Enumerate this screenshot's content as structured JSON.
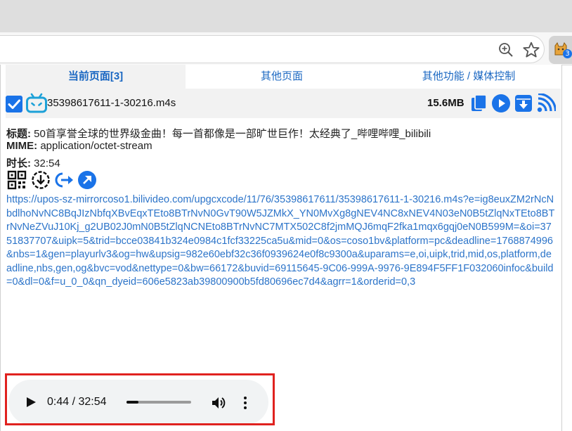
{
  "tabs": [
    {
      "label": "当前页面[3]",
      "active": true
    },
    {
      "label": "其他页面",
      "active": false
    },
    {
      "label": "其他功能 / 媒体控制",
      "active": false
    }
  ],
  "extension": {
    "badge": "3"
  },
  "media": {
    "filename": "35398617611-1-30216.m4s",
    "size": "15.6MB",
    "checked": true
  },
  "info": {
    "title_label": "标题:",
    "title_value": "50首享誉全球的世界级金曲！每一首都像是一部旷世巨作！太经典了_哔哩哔哩_bilibili",
    "mime_label": "MIME:",
    "mime_value": "application/octet-stream",
    "duration_label": "时长:",
    "duration_value": "32:54"
  },
  "url": "https://upos-sz-mirrorcoso1.bilivideo.com/upgcxcode/11/76/35398617611/35398617611-1-30216.m4s?e=ig8euxZM2rNcNbdlhoNvNC8BqJIzNbfqXBvEqxTEto8BTrNvN0GvT90W5JZMkX_YN0MvXg8gNEV4NC8xNEV4N03eN0B5tZlqNxTEto8BTrNvNeZVuJ10Kj_g2UB02J0mN0B5tZlqNCNEto8BTrNvNC7MTX502C8f2jmMQJ6mqF2fka1mqx6gqj0eN0B599M=&oi=3751837707&uipk=5&trid=bcce03841b324e0984c1fcf33225ca5u&mid=0&os=coso1bv&platform=pc&deadline=1768874996&nbs=1&gen=playurlv3&og=hw&upsig=982e60ebf32c36f0939624e0f8c9300a&uparams=e,oi,uipk,trid,mid,os,platform,deadline,nbs,gen,og&bvc=vod&nettype=0&bw=66172&buvid=69115645-9C06-999A-9976-9E894F5FF1F032060infoc&build=0&dl=0&f=u_0_0&qn_dyeid=606e5823ab39800900b5fd80696ec7d4&agrr=1&orderid=0,3",
  "player": {
    "current": "0:44",
    "separator": " / ",
    "total": "32:54",
    "progress": 0.022
  },
  "colors": {
    "accent": "#1a73e8",
    "link": "#2c74c9",
    "highlight": "#e0221f"
  }
}
